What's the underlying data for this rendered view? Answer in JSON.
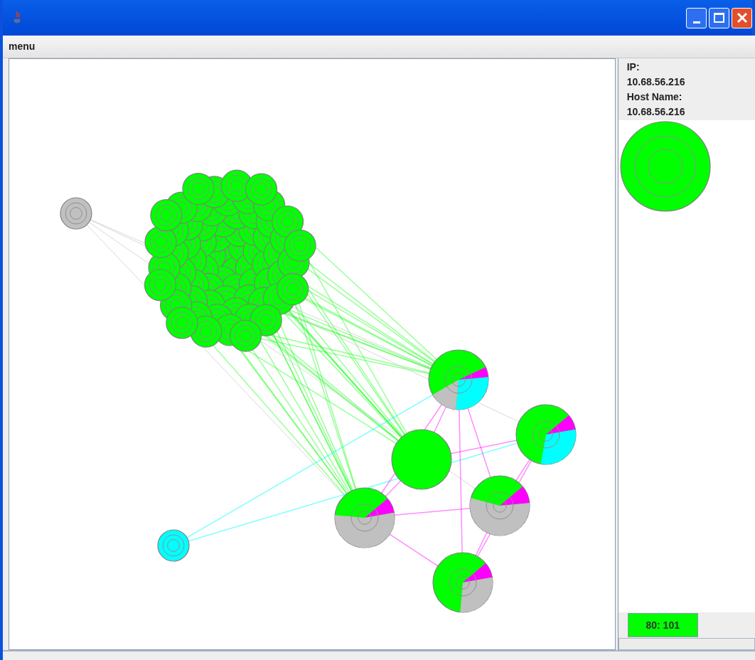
{
  "menu_bar": {
    "items": [
      "menu"
    ]
  },
  "details": {
    "ip_label": "IP:",
    "ip_value": "10.68.56.216",
    "host_label": "Host Name:",
    "host_value": "10.68.56.216"
  },
  "status": {
    "badge": "80: 101"
  }
}
